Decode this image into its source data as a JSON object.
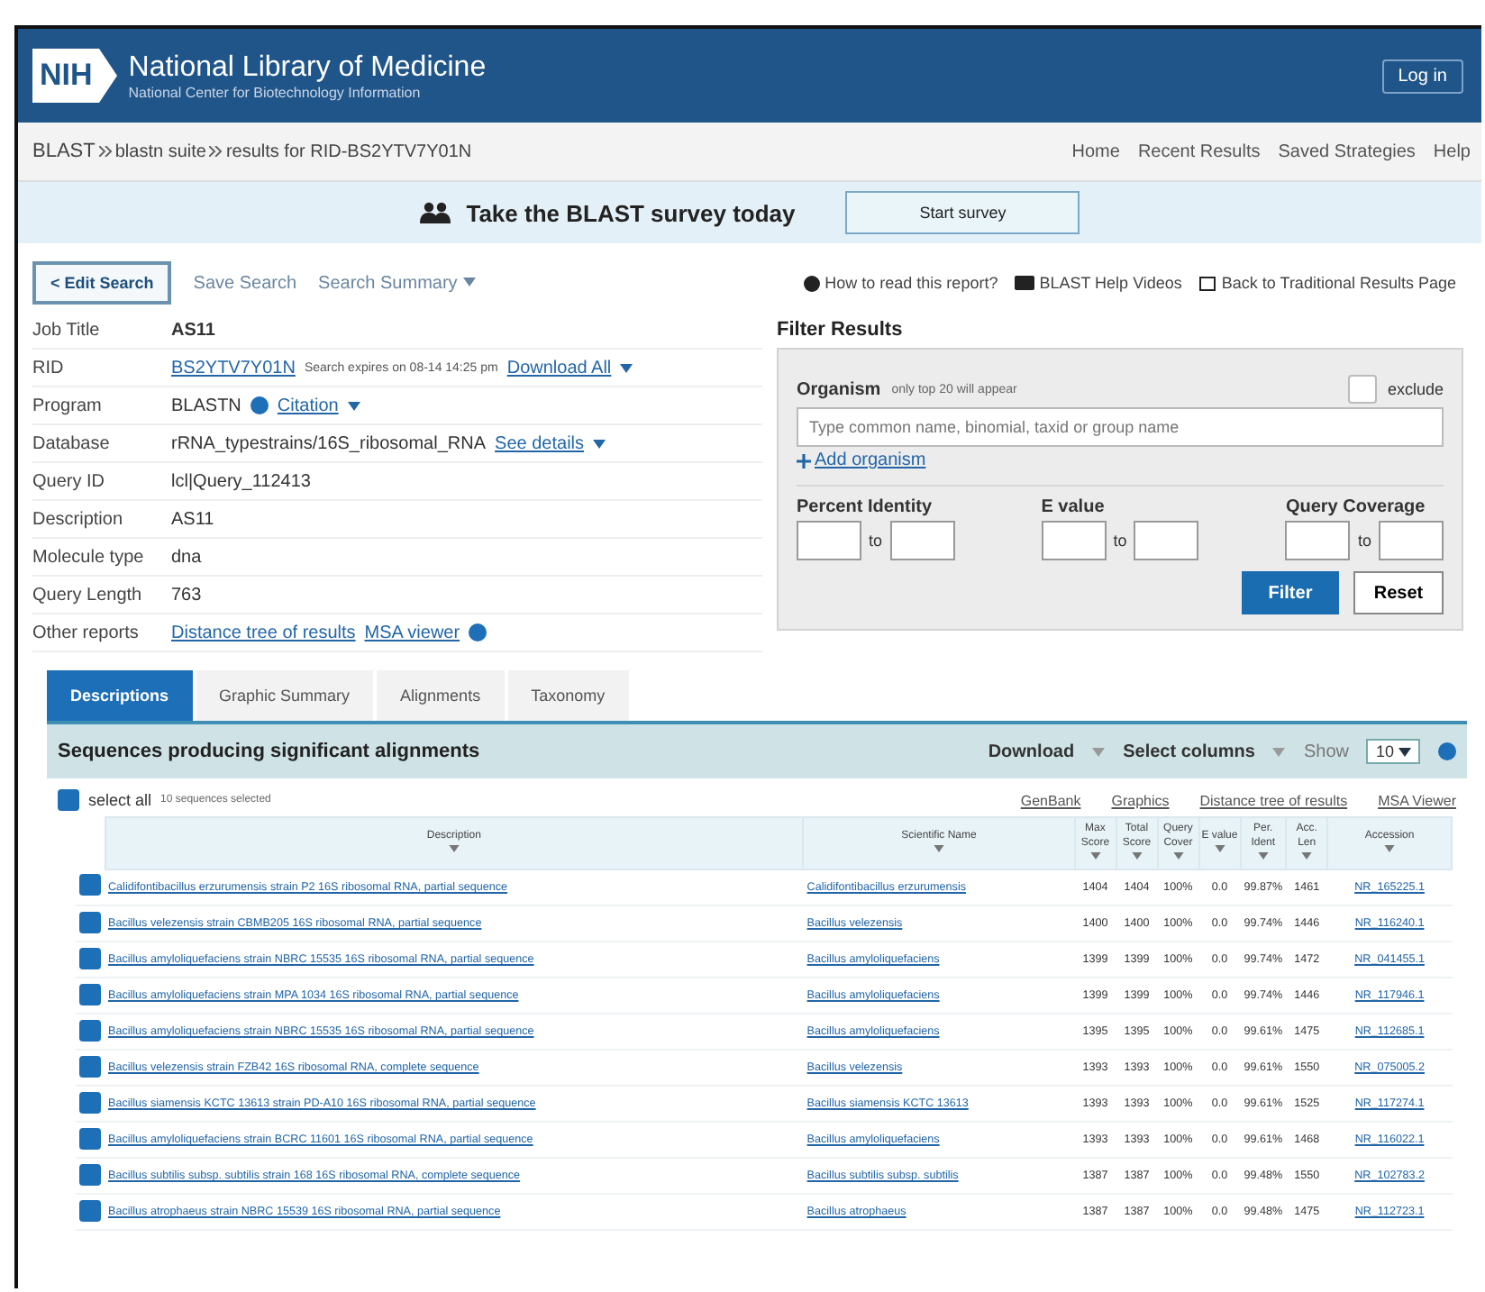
{
  "header": {
    "logo": "NIH",
    "title": "National Library of Medicine",
    "subtitle": "National Center for Biotechnology Information",
    "login": "Log in"
  },
  "breadcrumb": {
    "path": [
      "BLAST",
      "blastn suite",
      "results for RID-BS2YTV7Y01N"
    ],
    "links": [
      "Home",
      "Recent Results",
      "Saved Strategies",
      "Help"
    ]
  },
  "survey": {
    "text": "Take the BLAST survey today",
    "button": "Start survey"
  },
  "toolbar": {
    "edit": "< Edit Search",
    "save": "Save Search",
    "summary": "Search Summary",
    "links": [
      "How to read this report?",
      "BLAST Help Videos",
      "Back to Traditional Results Page"
    ]
  },
  "job": [
    {
      "label": "Job Title",
      "value": "AS11",
      "kind": "bold"
    },
    {
      "label": "RID",
      "value": "BS2YTV7Y01N",
      "note": "Search expires on 08-14 14:25 pm",
      "extra": "Download All",
      "kind": "link"
    },
    {
      "label": "Program",
      "value": "BLASTN",
      "extra": "Citation",
      "kind": "info"
    },
    {
      "label": "Database",
      "value": "rRNA_typestrains/16S_ribosomal_RNA",
      "extra": "See details",
      "kind": "plain"
    },
    {
      "label": "Query ID",
      "value": "lcl|Query_112413",
      "kind": "plain"
    },
    {
      "label": "Description",
      "value": "AS11",
      "kind": "plain"
    },
    {
      "label": "Molecule type",
      "value": "dna",
      "kind": "plain"
    },
    {
      "label": "Query Length",
      "value": "763",
      "kind": "plain"
    },
    {
      "label": "Other reports",
      "value": "Distance tree of results",
      "extra": "MSA viewer",
      "kind": "links"
    }
  ],
  "filter": {
    "title": "Filter Results",
    "organism": "Organism",
    "organism_hint": "only top 20 will appear",
    "exclude": "exclude",
    "exclude_checked": false,
    "placeholder": "Type common name, binomial, taxid or group name",
    "add": "Add organism",
    "groups": [
      {
        "label": "Percent Identity",
        "to": "to"
      },
      {
        "label": "E value",
        "to": "to"
      },
      {
        "label": "Query Coverage",
        "to": "to"
      }
    ],
    "filter_button": "Filter",
    "reset_button": "Reset"
  },
  "tabs": [
    {
      "label": "Descriptions",
      "selected": true
    },
    {
      "label": "Graphic Summary",
      "selected": false
    },
    {
      "label": "Alignments",
      "selected": false
    },
    {
      "label": "Taxonomy",
      "selected": false
    }
  ],
  "results": {
    "title": "Sequences producing significant alignments",
    "download": "Download",
    "select_columns": "Select columns",
    "show": "Show",
    "show_value": "10",
    "select_all": "select all",
    "select_all_checked": true,
    "selected_note": "10 sequences selected",
    "links": [
      "GenBank",
      "Graphics",
      "Distance tree of results",
      "MSA Viewer"
    ],
    "columns": [
      "Description",
      "Scientific Name",
      "Max Score",
      "Total Score",
      "Query Cover",
      "E value",
      "Per. Ident",
      "Acc. Len",
      "Accession"
    ],
    "rows": [
      {
        "checked": true,
        "cells": [
          "Calidifontibacillus erzurumensis strain P2 16S ribosomal RNA, partial sequence",
          "Calidifontibacillus erzurumensis",
          "1404",
          "1404",
          "100%",
          "0.0",
          "99.87%",
          "1461",
          "NR_165225.1"
        ]
      },
      {
        "checked": true,
        "cells": [
          "Bacillus velezensis strain CBMB205 16S ribosomal RNA, partial sequence",
          "Bacillus velezensis",
          "1400",
          "1400",
          "100%",
          "0.0",
          "99.74%",
          "1446",
          "NR_116240.1"
        ]
      },
      {
        "checked": true,
        "cells": [
          "Bacillus amyloliquefaciens strain NBRC 15535 16S ribosomal RNA, partial sequence",
          "Bacillus amyloliquefaciens",
          "1399",
          "1399",
          "100%",
          "0.0",
          "99.74%",
          "1472",
          "NR_041455.1"
        ]
      },
      {
        "checked": true,
        "cells": [
          "Bacillus amyloliquefaciens strain MPA 1034 16S ribosomal RNA, partial sequence",
          "Bacillus amyloliquefaciens",
          "1399",
          "1399",
          "100%",
          "0.0",
          "99.74%",
          "1446",
          "NR_117946.1"
        ]
      },
      {
        "checked": true,
        "cells": [
          "Bacillus amyloliquefaciens strain NBRC 15535 16S ribosomal RNA, partial sequence",
          "Bacillus amyloliquefaciens",
          "1395",
          "1395",
          "100%",
          "0.0",
          "99.61%",
          "1475",
          "NR_112685.1"
        ]
      },
      {
        "checked": true,
        "cells": [
          "Bacillus velezensis strain FZB42 16S ribosomal RNA, complete sequence",
          "Bacillus velezensis",
          "1393",
          "1393",
          "100%",
          "0.0",
          "99.61%",
          "1550",
          "NR_075005.2"
        ]
      },
      {
        "checked": true,
        "cells": [
          "Bacillus siamensis KCTC 13613 strain PD-A10 16S ribosomal RNA, partial sequence",
          "Bacillus siamensis KCTC 13613",
          "1393",
          "1393",
          "100%",
          "0.0",
          "99.61%",
          "1525",
          "NR_117274.1"
        ]
      },
      {
        "checked": true,
        "cells": [
          "Bacillus amyloliquefaciens strain BCRC 11601 16S ribosomal RNA, partial sequence",
          "Bacillus amyloliquefaciens",
          "1393",
          "1393",
          "100%",
          "0.0",
          "99.61%",
          "1468",
          "NR_116022.1"
        ]
      },
      {
        "checked": true,
        "cells": [
          "Bacillus subtilis subsp. subtilis strain 168 16S ribosomal RNA, complete sequence",
          "Bacillus subtilis subsp. subtilis",
          "1387",
          "1387",
          "100%",
          "0.0",
          "99.48%",
          "1550",
          "NR_102783.2"
        ]
      },
      {
        "checked": true,
        "cells": [
          "Bacillus atrophaeus strain NBRC 15539 16S ribosomal RNA, partial sequence",
          "Bacillus atrophaeus",
          "1387",
          "1387",
          "100%",
          "0.0",
          "99.48%",
          "1475",
          "NR_112723.1"
        ]
      }
    ]
  }
}
